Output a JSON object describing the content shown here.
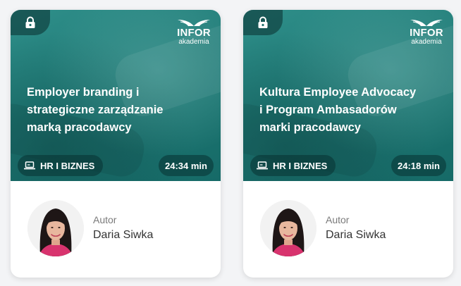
{
  "courses": [
    {
      "title_lines": [
        "Employer branding i",
        "strategiczne zarządzanie",
        "marką pracodawcy"
      ],
      "category": "HR I BIZNES",
      "duration": "24:34 min",
      "author_label": "Autor",
      "author_name": "Daria Siwka",
      "brand": {
        "name": "INFOR",
        "sub": "akademia"
      },
      "locked": true
    },
    {
      "title_lines": [
        "Kultura Employee Advocacy",
        "i Program Ambasadorów",
        "marki pracodawcy"
      ],
      "category": "HR I BIZNES",
      "duration": "24:18 min",
      "author_label": "Autor",
      "author_name": "Daria Siwka",
      "brand": {
        "name": "INFOR",
        "sub": "akademia"
      },
      "locked": true
    }
  ],
  "icons": {
    "lock": "lock-icon",
    "category": "laptop-icon",
    "brand": "wings-logo"
  },
  "colors": {
    "hero": "#1f7a76",
    "pill": "#0d3a3a",
    "card": "#ffffff",
    "page": "#f3f4f6",
    "author_label": "#7a7a7a",
    "author_name": "#333333"
  }
}
